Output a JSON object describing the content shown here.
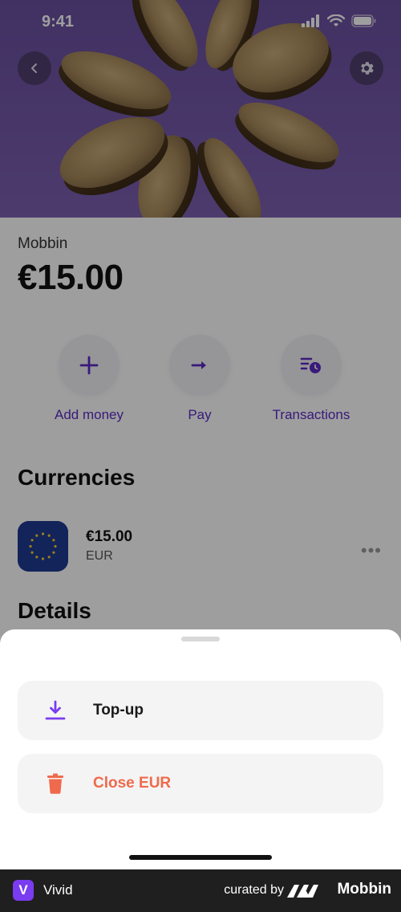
{
  "status_bar": {
    "time": "9:41"
  },
  "account": {
    "name": "Mobbin",
    "balance": "€15.00"
  },
  "actions": [
    {
      "label": "Add money",
      "icon": "plus-icon"
    },
    {
      "label": "Pay",
      "icon": "arrow-right-icon"
    },
    {
      "label": "Transactions",
      "icon": "transactions-clock-icon"
    }
  ],
  "currencies": {
    "title": "Currencies",
    "items": [
      {
        "amount": "€15.00",
        "code": "EUR",
        "icon": "eu-flag-icon"
      }
    ]
  },
  "details": {
    "title": "Details"
  },
  "sheet": {
    "topup_label": "Top-up",
    "close_label": "Close EUR"
  },
  "footer": {
    "app_name": "Vivid",
    "app_logo_letter": "V",
    "curated_by": "curated by",
    "brand": "Mobbin"
  },
  "colors": {
    "accent": "#5b2bc6",
    "danger": "#ef6a4c",
    "hero": "#6a4fa0"
  }
}
